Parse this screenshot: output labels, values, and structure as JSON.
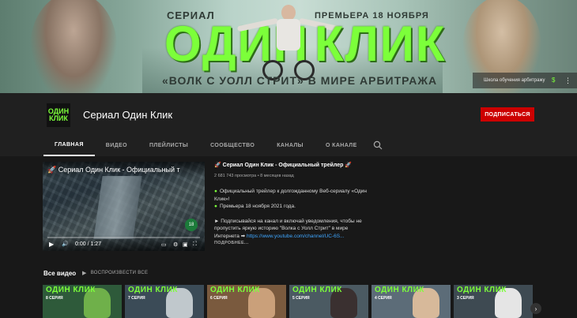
{
  "banner": {
    "kicker_left": "СЕРИАЛ",
    "kicker_right": "ПРЕМЬЕРА 18 НОЯБРЯ",
    "big_word_1": "ОДИН",
    "big_word_2": "КЛИК",
    "tagline": "«ВОЛК С УОЛЛ СТРИТ» В МИРЕ АРБИТРАЖА",
    "link_label": "Школа обучения арбитражу"
  },
  "channel": {
    "avatar_line_1": "ОДИН",
    "avatar_line_2": "КЛИК",
    "name": "Сериал Один Клик",
    "subscribe_label": "ПОДПИСАТЬСЯ"
  },
  "tabs": [
    {
      "label": "ГЛАВНАЯ",
      "active": true
    },
    {
      "label": "ВИДЕО"
    },
    {
      "label": "ПЛЕЙЛИСТЫ"
    },
    {
      "label": "СООБЩЕСТВО"
    },
    {
      "label": "КАНАЛЫ"
    },
    {
      "label": "О КАНАЛЕ"
    }
  ],
  "player": {
    "title": "🚀 Сериал Один Клик - Официальный т",
    "badge": "18",
    "time": "0:00 / 1:27",
    "progress_fraction": 0.0
  },
  "featured": {
    "title": "🚀 Сериал Один Клик - Официальный трейлер 🚀",
    "meta": "2 681 743 просмотра • 8 месяцев назад",
    "desc_1a": "Официальный трейлер к долгожданному Веб-сериалу «Один Клик»!",
    "desc_1b": "Премьера 18 ноября 2021 года.",
    "desc_2": "► Подписывайся на канал и включай уведомления, чтобы не пропустить яркую историю \"Волка с Уолл Стрит\" в мире Интернета ➡",
    "desc_link": "https://www.youtube.com/channel/UC-6S...",
    "more": "ПОДРОБНЕЕ..."
  },
  "section": {
    "title": "Все видео",
    "play_all": "ВОСПРОИЗВЕСТИ ВСЕ"
  },
  "videos": [
    {
      "logo": "ОДИН КЛИК",
      "episode": "8 СЕРИЯ",
      "bg": "#2e5a3a",
      "fig": "#6fb04a"
    },
    {
      "logo": "ОДИН КЛИК",
      "episode": "7 СЕРИЯ",
      "bg": "#3b4b57",
      "fig": "#c0c8cc"
    },
    {
      "logo": "ОДИН КЛИК",
      "episode": "6 СЕРИЯ",
      "bg": "#7a5a3e",
      "fig": "#caa07a"
    },
    {
      "logo": "ОДИН КЛИК",
      "episode": "5 СЕРИЯ",
      "bg": "#4b5a62",
      "fig": "#3a3030"
    },
    {
      "logo": "ОДИН КЛИК",
      "episode": "4 СЕРИЯ",
      "bg": "#5c6c78",
      "fig": "#d7b99a"
    },
    {
      "logo": "ОДИН КЛИК",
      "episode": "3 СЕРИЯ",
      "bg": "#3e4a52",
      "fig": "#e5e5e5"
    }
  ]
}
